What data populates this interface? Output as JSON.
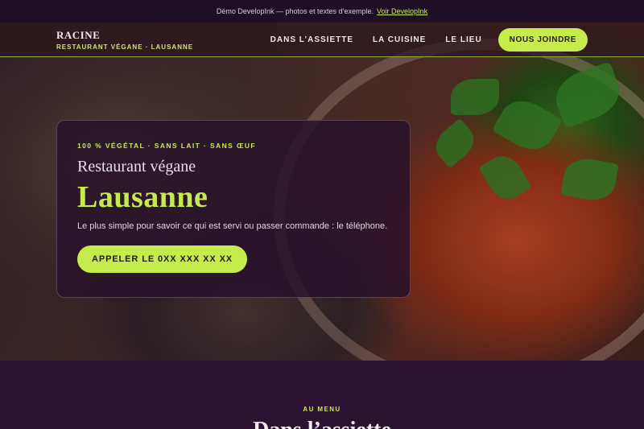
{
  "demo_banner": {
    "text": "Démo DevelopInk — photos et textes d’exemple.",
    "link_label": "Voir DevelopInk"
  },
  "brand": {
    "name": "RACINE",
    "subtitle": "RESTAURANT VÉGANE · LAUSANNE"
  },
  "nav": {
    "items": [
      {
        "label": "DANS L’ASSIETTE"
      },
      {
        "label": "LA CUISINE"
      },
      {
        "label": "LE LIEU"
      }
    ],
    "cta_label": "NOUS JOINDRE"
  },
  "hero": {
    "tagline": "100 % VÉGÉTAL · SANS LAIT · SANS ŒUF",
    "title": "Restaurant végane",
    "city": "Lausanne",
    "description": "Le plus simple pour savoir ce qui est servi ou passer commande : le téléphone.",
    "call_label": "APPELER LE 0XX XXX XX XX"
  },
  "menu_section": {
    "kicker": "AU MENU",
    "heading": "Dans l’assiette"
  },
  "colors": {
    "accent": "#c6ec4b",
    "background": "#2b1331",
    "card": "#2a122a"
  }
}
